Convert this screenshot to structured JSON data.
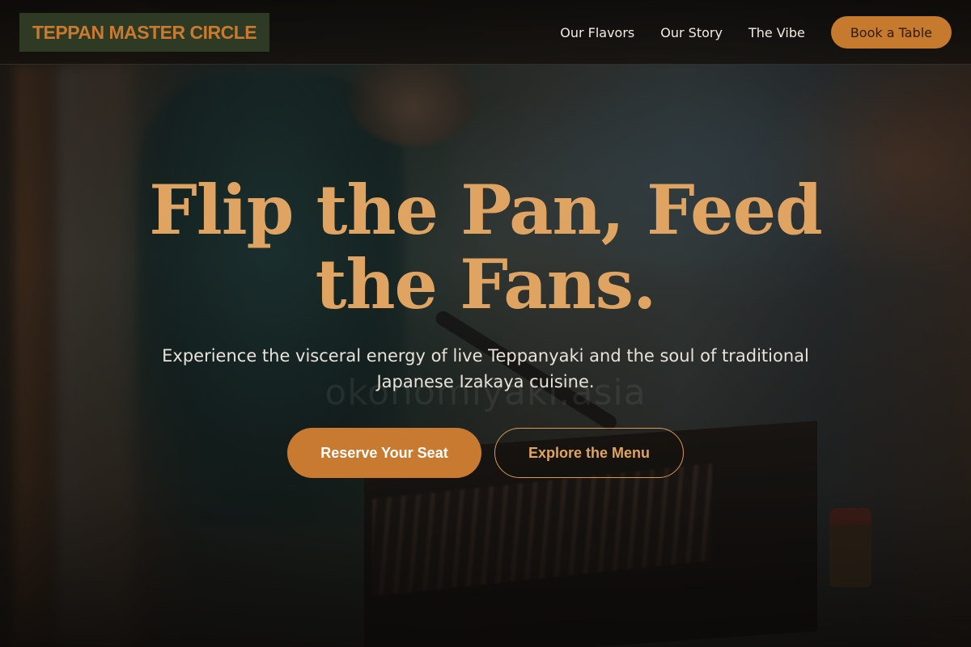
{
  "brand": {
    "name": "TEPPAN MASTER CIRCLE",
    "accent_color": "#c87a30",
    "logo_bg_color": "#2f3a24"
  },
  "nav": {
    "links": [
      {
        "label": "Our Flavors"
      },
      {
        "label": "Our Story"
      },
      {
        "label": "The Vibe"
      }
    ],
    "cta_label": "Book a Table"
  },
  "hero": {
    "headline_line1": "Flip the Pan, Feed",
    "headline_line2": "the Fans.",
    "watermark": "okonomiyaki.asia",
    "subhead_line1": "Experience the visceral energy of live Teppanyaki and the soul of traditional",
    "subhead_line2": "Japanese Izakaya cuisine.",
    "primary_button": "Reserve Your Seat",
    "secondary_button": "Explore the Menu",
    "headline_color": "#e0a462"
  }
}
